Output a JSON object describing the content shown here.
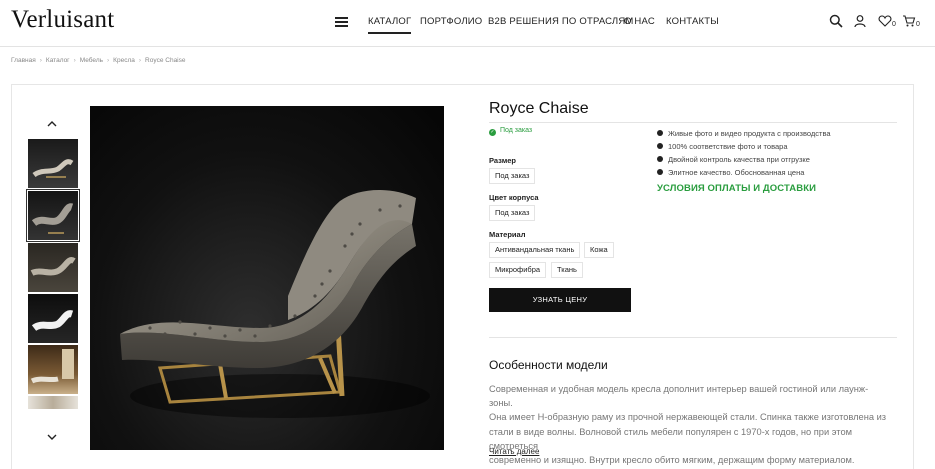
{
  "header": {
    "logo": "Verluisant",
    "nav": [
      "КАТАЛОГ",
      "ПОРТФОЛИО",
      "B2B РЕШЕНИЯ ПО ОТРАСЛЯМ",
      "О НАС",
      "КОНТАКТЫ"
    ],
    "wishlist_count": "0",
    "cart_count": "0"
  },
  "breadcrumb": [
    "Главная",
    "Каталог",
    "Мебель",
    "Кресла",
    "Royce Chaise"
  ],
  "product": {
    "title": "Royce Chaise",
    "availability": "Под заказ",
    "size_label": "Размер",
    "size_value": "Под заказ",
    "body_color_label": "Цвет корпуса",
    "body_color_value": "Под заказ",
    "material_label": "Материал",
    "materials": [
      "Антивандальная ткань",
      "Кожа",
      "Микрофибра",
      "Ткань"
    ],
    "price_button": "УЗНАТЬ ЦЕНУ"
  },
  "features": [
    "Живые фото и видео продукта с производства",
    "100% соответствие фото и товара",
    "Двойной контроль качества при отгрузке",
    "Элитное качество. Обоснованная цена"
  ],
  "terms_link": "УСЛОВИЯ ОПЛАТЫ И ДОСТАВКИ",
  "details": {
    "heading": "Особенности модели",
    "text_lines": [
      "Современная и удобная модель кресла дополнит интерьер вашей гостиной или лаунж-зоны.",
      "Она имеет Н-образную раму из прочной нержавеющей стали. Спинка также изготовлена из",
      "стали в виде волны. Волновой стиль мебели популярен с 1970-х годов, но при этом смотреться",
      "современно и изящно. Внутри кресло обито мягким, держащим форму материалом. Снаруж..."
    ],
    "read_more": "Читать далее"
  },
  "colors": {
    "accent_green": "#2a9d3f",
    "button_bg": "#111111"
  }
}
